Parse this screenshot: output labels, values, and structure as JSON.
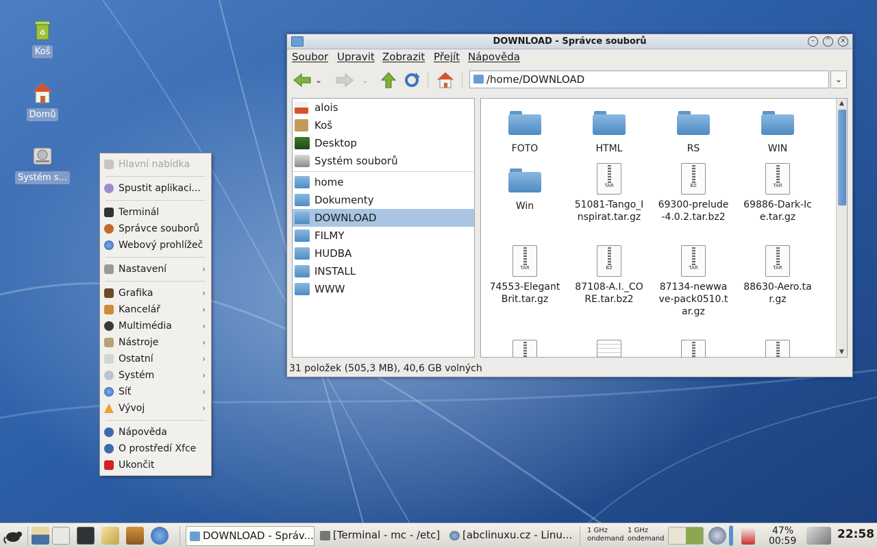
{
  "desktop": {
    "icons": [
      {
        "label": "Koš",
        "icon": "trash-icon"
      },
      {
        "label": "Domů",
        "icon": "home-icon"
      },
      {
        "label": "Systém s...",
        "icon": "drive-icon"
      }
    ]
  },
  "menu": {
    "header": "Hlavní nabídka",
    "items": [
      {
        "label": "Spustit aplikaci...",
        "icon": "run-icon"
      },
      {
        "label": "Terminál",
        "icon": "terminal-icon"
      },
      {
        "label": "Správce souborů",
        "icon": "file-manager-icon"
      },
      {
        "label": "Webový prohlížeč",
        "icon": "globe-icon"
      },
      {
        "label": "Nastavení",
        "icon": "settings-icon",
        "submenu": true
      },
      {
        "label": "Grafika",
        "icon": "graphics-icon",
        "submenu": true
      },
      {
        "label": "Kancelář",
        "icon": "office-icon",
        "submenu": true
      },
      {
        "label": "Multimédia",
        "icon": "multimedia-icon",
        "submenu": true
      },
      {
        "label": "Nástroje",
        "icon": "tools-icon",
        "submenu": true
      },
      {
        "label": "Ostatní",
        "icon": "other-icon",
        "submenu": true
      },
      {
        "label": "Systém",
        "icon": "system-icon",
        "submenu": true
      },
      {
        "label": "Síť",
        "icon": "network-icon",
        "submenu": true
      },
      {
        "label": "Vývoj",
        "icon": "development-icon",
        "submenu": true
      },
      {
        "label": "Nápověda",
        "icon": "help-icon"
      },
      {
        "label": "O prostředí Xfce",
        "icon": "info-icon"
      },
      {
        "label": "Ukončit",
        "icon": "power-icon"
      }
    ],
    "submenu_arrow": "›"
  },
  "window": {
    "title": "DOWNLOAD - Správce souborů",
    "menubar": [
      "Soubor",
      "Upravit",
      "Zobrazit",
      "Přejít",
      "Nápověda"
    ],
    "path": "/home/DOWNLOAD",
    "sidebar": {
      "places": [
        {
          "label": "alois",
          "icon": "user-home-icon"
        },
        {
          "label": "Koš",
          "icon": "trash-icon"
        },
        {
          "label": "Desktop",
          "icon": "desktop-icon"
        },
        {
          "label": "Systém souborů",
          "icon": "drive-icon"
        }
      ],
      "folders": [
        {
          "label": "home"
        },
        {
          "label": "Dokumenty"
        },
        {
          "label": "DOWNLOAD",
          "selected": true
        },
        {
          "label": "FILMY"
        },
        {
          "label": "HUDBA"
        },
        {
          "label": "INSTALL"
        },
        {
          "label": "WWW"
        }
      ]
    },
    "files": [
      {
        "name": "FOTO",
        "type": "folder"
      },
      {
        "name": "HTML",
        "type": "folder"
      },
      {
        "name": "RS",
        "type": "folder"
      },
      {
        "name": "WIN",
        "type": "folder"
      },
      {
        "name": "Win",
        "type": "folder"
      },
      {
        "name": "51081-Tango_Inspirat.tar.gz",
        "type": "archive",
        "tag": "TAR"
      },
      {
        "name": "69300-prelude-4.0.2.tar.bz2",
        "type": "archive",
        "tag": "BZ"
      },
      {
        "name": "69886-Dark-Ice.tar.gz",
        "type": "archive",
        "tag": "TAR"
      },
      {
        "name": "74553-ElegantBrit.tar.gz",
        "type": "archive",
        "tag": "TAR"
      },
      {
        "name": "87108-A.I._CORE.tar.bz2",
        "type": "archive",
        "tag": "BZ"
      },
      {
        "name": "87134-newwave-pack0510.tar.gz",
        "type": "archive",
        "tag": "TAR"
      },
      {
        "name": "88630-Aero.tar.gz",
        "type": "archive",
        "tag": "TAR"
      }
    ],
    "status": "31 položek (505,3 MB), 40,6 GB volných"
  },
  "taskbar": {
    "tasks": [
      {
        "label": "DOWNLOAD - Správ...",
        "active": true
      },
      {
        "label": "[Terminal - mc - /etc]"
      },
      {
        "label": "[abclinuxu.cz - Linu..."
      }
    ],
    "cpu1": {
      "freq": "1 GHz",
      "governor": "ondemand"
    },
    "cpu2": {
      "freq": "1 GHz",
      "governor": "ondemand"
    },
    "battery_percent": "47%",
    "battery_time": "00:59",
    "clock": "22:58"
  },
  "colors": {
    "desktop_bg": "#27549a",
    "selection": "#a9c5e3",
    "folder_blue": "#5f97c9"
  }
}
